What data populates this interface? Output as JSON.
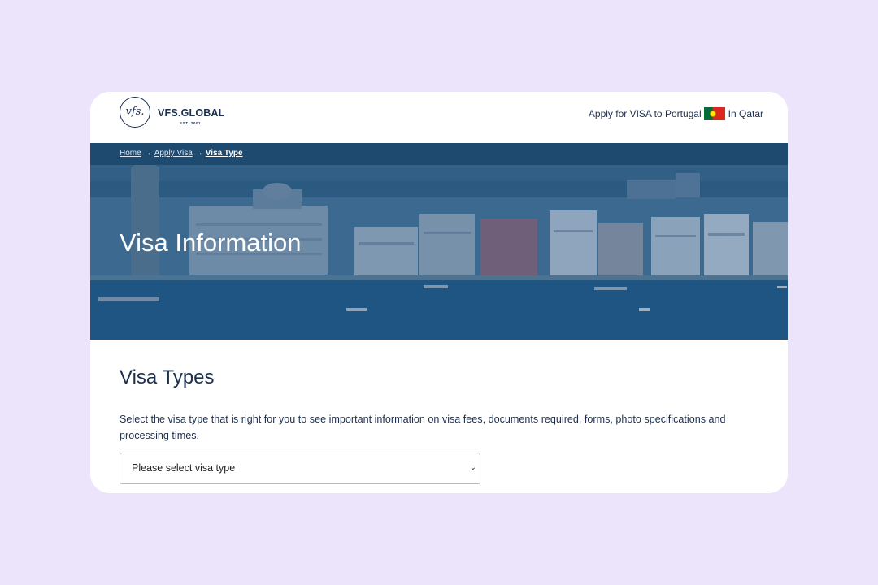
{
  "logo": {
    "monogram": "vfs.",
    "name": "VFS.GLOBAL",
    "est": "EST. 2001"
  },
  "header": {
    "apply_text": "Apply for VISA to Portugal",
    "location_text": "In Qatar",
    "flag_icon": "portugal-flag-icon"
  },
  "breadcrumb": {
    "home": "Home",
    "apply_visa": "Apply Visa",
    "current": "Visa Type",
    "separator": "→"
  },
  "hero": {
    "title": "Visa Information"
  },
  "main": {
    "heading": "Visa Types",
    "description": "Select the visa type that is right for you to see important information on visa fees, documents required, forms, photo specifications and processing times.",
    "select_value": "Please select visa type"
  },
  "colors": {
    "background": "#ece4fb",
    "navy": "#1c2f4f",
    "hero_blue": "#2b5980",
    "breadcrumb_bar": "#1f4a6f"
  }
}
